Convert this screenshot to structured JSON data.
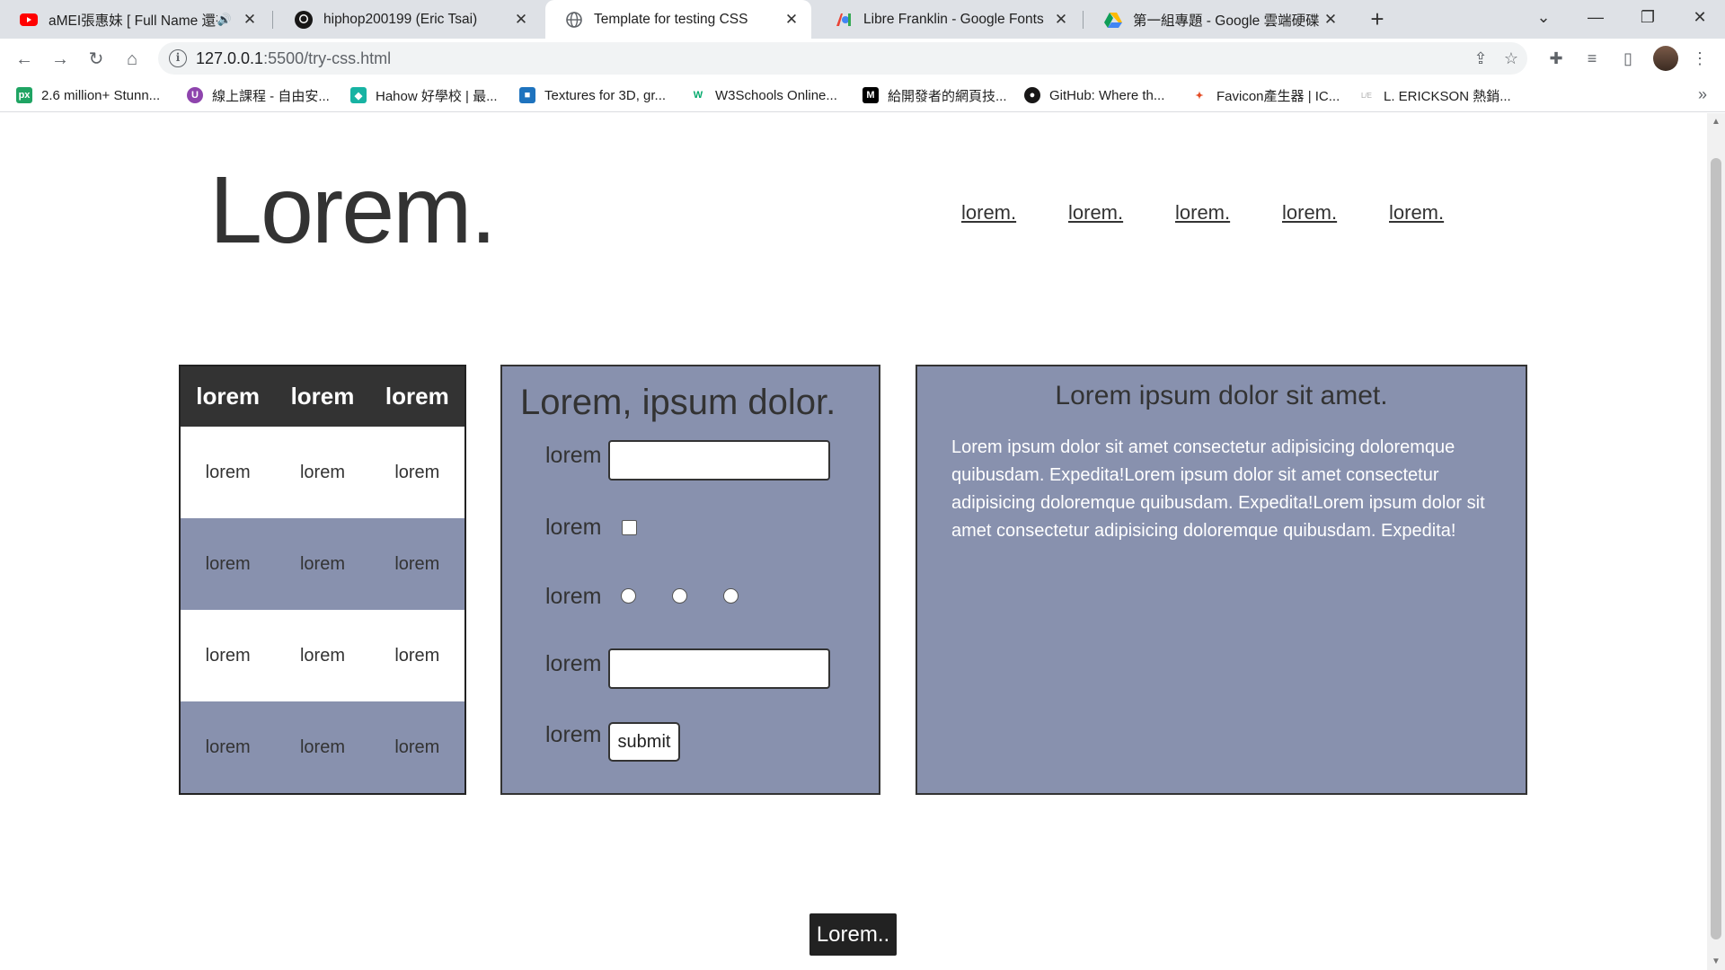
{
  "browser": {
    "tabs": [
      {
        "title": "aMEI張惠妹 [ Full Name 還有",
        "favicon": "youtube-icon",
        "color": "#ff0000",
        "audio": true,
        "active": false
      },
      {
        "title": "hiphop200199 (Eric Tsai)",
        "favicon": "github-icon",
        "color": "#181717",
        "audio": false,
        "active": false
      },
      {
        "title": "Template for testing CSS",
        "favicon": "globe-icon",
        "color": "#5f6368",
        "audio": false,
        "active": true
      },
      {
        "title": "Libre Franklin - Google Fonts",
        "favicon": "google-fonts-icon",
        "color": "#4285f4",
        "audio": false,
        "active": false
      },
      {
        "title": "第一組專題 - Google 雲端硬碟",
        "favicon": "google-drive-icon",
        "color": "#1fa463",
        "audio": false,
        "active": false
      }
    ],
    "url_host": "127.0.0.1",
    "url_path": ":5500/try-css.html",
    "bookmarks": [
      {
        "label": "2.6 million+ Stunn...",
        "icon": "px-icon",
        "color": "#1fa463",
        "glyph": "px"
      },
      {
        "label": "線上課程 - 自由安...",
        "icon": "u-icon",
        "color": "#8e44ad",
        "glyph": "U"
      },
      {
        "label": "Hahow 好學校 | 最...",
        "icon": "hahow-icon",
        "color": "#17b3a3",
        "glyph": "◆"
      },
      {
        "label": "Textures for 3D, gr...",
        "icon": "cube-icon",
        "color": "#1e73be",
        "glyph": "■"
      },
      {
        "label": "W3Schools Online...",
        "icon": "w3-icon",
        "color": "#04aa6d",
        "glyph": "W"
      },
      {
        "label": "給開發者的網頁技...",
        "icon": "mdn-icon",
        "color": "#000000",
        "glyph": "M"
      },
      {
        "label": "GitHub: Where th...",
        "icon": "github-icon",
        "color": "#181717",
        "glyph": "●"
      },
      {
        "label": "Favicon產生器 | IC...",
        "icon": "favicon-icon",
        "color": "#e44d26",
        "glyph": "✦"
      },
      {
        "label": "L. ERICKSON 熱銷...",
        "icon": "le-icon",
        "color": "#aaaaaa",
        "glyph": "L/E"
      }
    ]
  },
  "header": {
    "logo": "Lorem.",
    "nav": [
      "lorem.",
      "lorem.",
      "lorem.",
      "lorem.",
      "lorem."
    ]
  },
  "table": {
    "headers": [
      "lorem",
      "lorem",
      "lorem"
    ],
    "rows": [
      [
        "lorem",
        "lorem",
        "lorem"
      ],
      [
        "lorem",
        "lorem",
        "lorem"
      ],
      [
        "lorem",
        "lorem",
        "lorem"
      ],
      [
        "lorem",
        "lorem",
        "lorem"
      ]
    ]
  },
  "form": {
    "title": "Lorem, ipsum dolor.",
    "labels": [
      "lorem",
      "lorem",
      "lorem",
      "lorem",
      "lorem"
    ],
    "input1_value": "",
    "input2_value": "",
    "submit_label": "submit"
  },
  "article": {
    "title": "Lorem ipsum dolor sit amet.",
    "body": "Lorem ipsum dolor sit amet consectetur adipisicing doloremque quibusdam. Expedita!Lorem ipsum dolor sit amet consectetur adipisicing doloremque quibusdam. Expedita!Lorem ipsum dolor sit amet consectetur adipisicing doloremque quibusdam. Expedita!"
  },
  "footer_button": "Lorem..",
  "colors": {
    "panel": "#8891ae",
    "dark": "#333333"
  }
}
